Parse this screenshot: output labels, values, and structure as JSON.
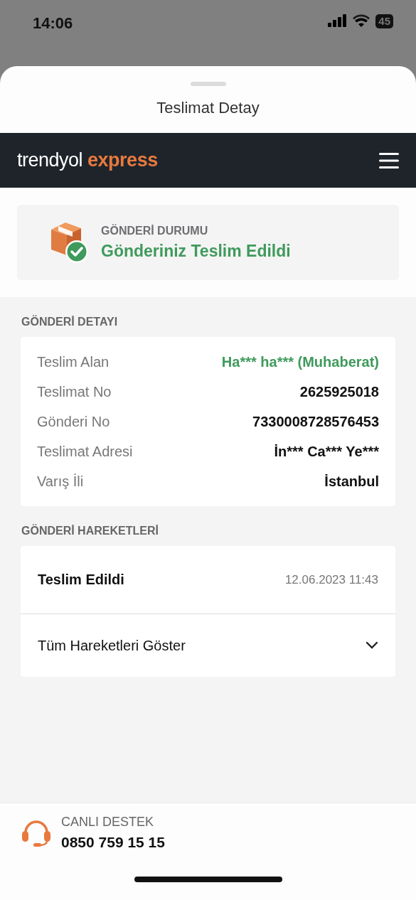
{
  "status_bar": {
    "time": "14:06",
    "battery": "45"
  },
  "sheet": {
    "title": "Teslimat Detay"
  },
  "brand": {
    "name": "trendyol",
    "suffix": "express"
  },
  "shipment_status": {
    "label": "GÖNDERİ DURUMU",
    "value": "Gönderiniz Teslim Edildi"
  },
  "details": {
    "heading": "GÖNDERİ DETAYI",
    "rows": [
      {
        "label": "Teslim Alan",
        "value": "Ha*** ha*** (Muhaberat)",
        "highlight": true
      },
      {
        "label": "Teslimat No",
        "value": "2625925018",
        "highlight": false
      },
      {
        "label": "Gönderi No",
        "value": "7330008728576453",
        "highlight": false
      },
      {
        "label": "Teslimat Adresi",
        "value": "İn*** Ca*** Ye***",
        "highlight": false
      },
      {
        "label": "Varış İli",
        "value": "İstanbul",
        "highlight": false
      }
    ]
  },
  "movements": {
    "heading": "GÖNDERİ HAREKETLERİ",
    "events": [
      {
        "title": "Teslim Edildi",
        "date": "12.06.2023 11:43"
      }
    ],
    "show_all": {
      "label": "Tüm Hareketleri Göster",
      "expanded": false
    }
  },
  "support": {
    "label": "CANLI DESTEK",
    "phone": "0850 759 15 15"
  }
}
